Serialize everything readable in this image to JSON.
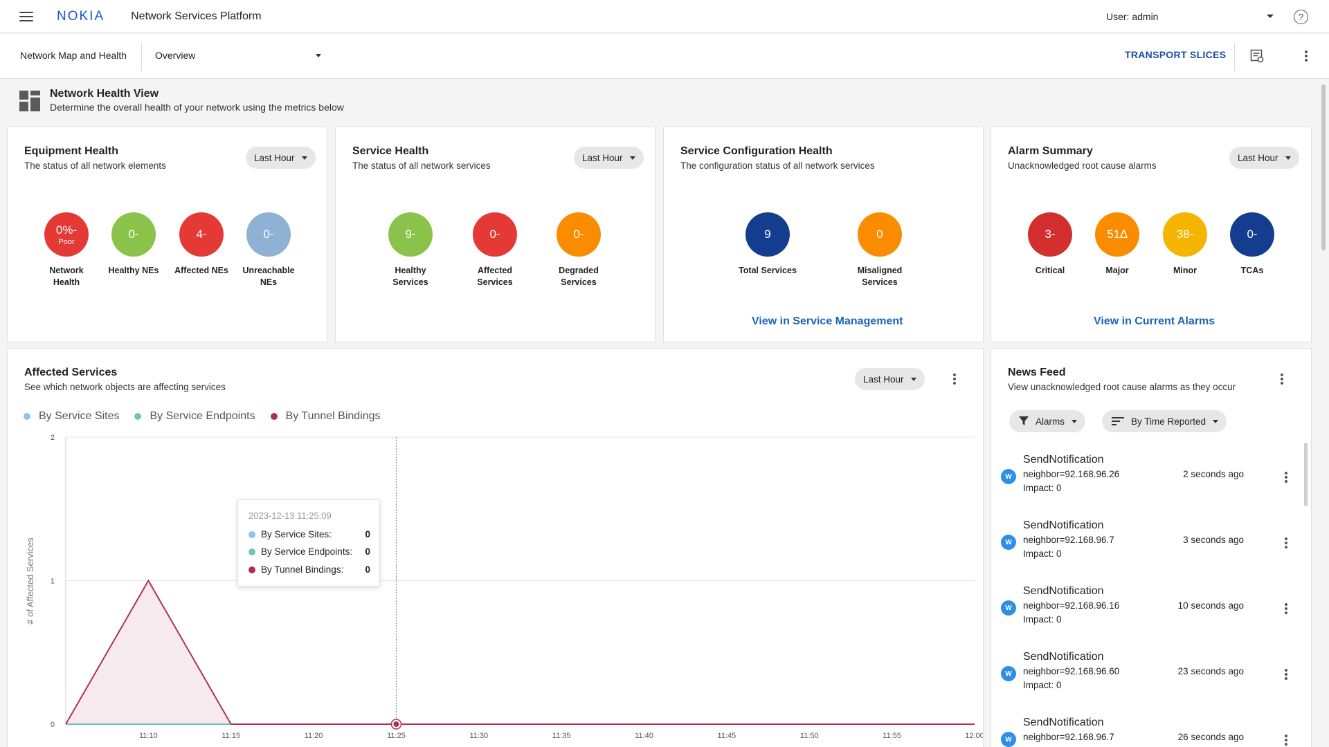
{
  "header": {
    "logo": "NOKIA",
    "app_title": "Network Services Platform",
    "user_label": "User: admin"
  },
  "subheader": {
    "breadcrumb": "Network Map and Health",
    "view_select": "Overview",
    "transport_button": "TRANSPORT SLICES"
  },
  "health_view": {
    "title": "Network Health View",
    "subtitle": "Determine the overall health of your network using the metrics below"
  },
  "equipment_health": {
    "title": "Equipment Health",
    "subtitle": "The status of all network elements",
    "time_filter": "Last Hour",
    "metrics": [
      {
        "value": "0%-",
        "sub": "Poor",
        "label": "Network Health",
        "color": "#e53935"
      },
      {
        "value": "0-",
        "label": "Healthy NEs",
        "color": "#8bc34a"
      },
      {
        "value": "4-",
        "label": "Affected NEs",
        "color": "#e53935"
      },
      {
        "value": "0-",
        "label": "Unreachable NEs",
        "color": "#8fb1d3"
      }
    ]
  },
  "service_health": {
    "title": "Service Health",
    "subtitle": "The status of all network services",
    "time_filter": "Last Hour",
    "metrics": [
      {
        "value": "9-",
        "label": "Healthy Services",
        "color": "#8bc34a"
      },
      {
        "value": "0-",
        "label": "Affected Services",
        "color": "#e53935"
      },
      {
        "value": "0-",
        "label": "Degraded Services",
        "color": "#fb8c00"
      }
    ]
  },
  "service_config_health": {
    "title": "Service Configuration Health",
    "subtitle": "The configuration status of all network services",
    "metrics": [
      {
        "value": "9",
        "label": "Total Services",
        "color": "#153d8f"
      },
      {
        "value": "0",
        "label": "Misaligned Services",
        "color": "#fb8c00"
      }
    ],
    "link": "View in Service Management"
  },
  "alarm_summary": {
    "title": "Alarm Summary",
    "subtitle": "Unacknowledged root cause alarms",
    "time_filter": "Last Hour",
    "metrics": [
      {
        "value": "3-",
        "label": "Critical",
        "color": "#d32f2f"
      },
      {
        "value": "51∆",
        "label": "Major",
        "color": "#fb8c00"
      },
      {
        "value": "38-",
        "label": "Minor",
        "color": "#f4b400"
      },
      {
        "value": "0-",
        "label": "TCAs",
        "color": "#153d8f"
      }
    ],
    "link": "View in Current Alarms"
  },
  "affected_services": {
    "title": "Affected Services",
    "subtitle": "See which network objects are affecting services",
    "time_filter": "Last Hour",
    "legend": [
      {
        "name": "By Service Sites",
        "color": "#8ec3ea"
      },
      {
        "name": "By Service Endpoints",
        "color": "#6fc6b8"
      },
      {
        "name": "By Tunnel Bindings",
        "color": "#b03054"
      }
    ],
    "tooltip": {
      "date": "2023-12-13 11:25:09",
      "rows": [
        {
          "label": "By Service Sites:",
          "value": "0",
          "color": "#8ec3ea"
        },
        {
          "label": "By Service Endpoints:",
          "value": "0",
          "color": "#6fc6b8"
        },
        {
          "label": "By Tunnel Bindings:",
          "value": "0",
          "color": "#b03054"
        }
      ]
    }
  },
  "chart_data": {
    "type": "area",
    "ylabel": "# of Affected Services",
    "ylim": [
      0,
      2
    ],
    "yticks": [
      "0",
      "1",
      "2"
    ],
    "x": [
      "11:05",
      "11:10",
      "11:15",
      "11:20",
      "11:25",
      "11:30",
      "11:35",
      "11:40",
      "11:45",
      "11:50",
      "11:55",
      "12:00"
    ],
    "xticks": [
      "11:10",
      "11:15",
      "11:20",
      "11:25",
      "11:30",
      "11:35",
      "11:40",
      "11:45",
      "11:50",
      "11:55",
      "12:00"
    ],
    "series": [
      {
        "name": "By Service Sites",
        "values": [
          0,
          0,
          0,
          0,
          0,
          0,
          0,
          0,
          0,
          0,
          0,
          0
        ]
      },
      {
        "name": "By Service Endpoints",
        "values": [
          0,
          0,
          0,
          0,
          0,
          0,
          0,
          0,
          0,
          0,
          0,
          0
        ]
      },
      {
        "name": "By Tunnel Bindings",
        "values": [
          0,
          1,
          0,
          0,
          0,
          0,
          0,
          0,
          0,
          0,
          0,
          0
        ]
      }
    ],
    "highlight_x": "11:25",
    "grid": true,
    "legend_position": "top-left"
  },
  "news_feed": {
    "title": "News Feed",
    "subtitle": "View unacknowledged root cause alarms as they occur",
    "filter_type": "Alarms",
    "sort": "By Time Reported",
    "items": [
      {
        "avatar": "W",
        "title": "SendNotification",
        "detail": "neighbor=92.168.96.26",
        "impact": "Impact: 0",
        "time": "2 seconds ago"
      },
      {
        "avatar": "W",
        "title": "SendNotification",
        "detail": "neighbor=92.168.96.7",
        "impact": "Impact: 0",
        "time": "3 seconds ago"
      },
      {
        "avatar": "W",
        "title": "SendNotification",
        "detail": "neighbor=92.168.96.16",
        "impact": "Impact: 0",
        "time": "10 seconds ago"
      },
      {
        "avatar": "W",
        "title": "SendNotification",
        "detail": "neighbor=92.168.96.60",
        "impact": "Impact: 0",
        "time": "23 seconds ago"
      },
      {
        "avatar": "W",
        "title": "SendNotification",
        "detail": "neighbor=92.168.96.7",
        "impact": "",
        "time": "26 seconds ago"
      }
    ]
  }
}
